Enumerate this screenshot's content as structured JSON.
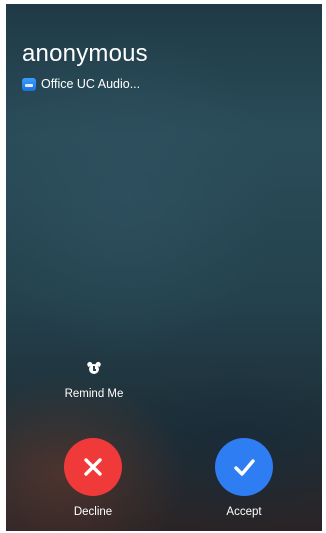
{
  "call": {
    "caller_name": "anonymous",
    "app_name": "Office UC Audio..."
  },
  "actions": {
    "remind_label": "Remind Me",
    "decline_label": "Decline",
    "accept_label": "Accept"
  },
  "icons": {
    "app": "phone-app-icon",
    "remind": "alarm-clock-icon",
    "decline": "x-icon",
    "accept": "checkmark-icon"
  },
  "colors": {
    "decline": "#f03a3a",
    "accept": "#2f7df2",
    "text": "#ffffff"
  }
}
